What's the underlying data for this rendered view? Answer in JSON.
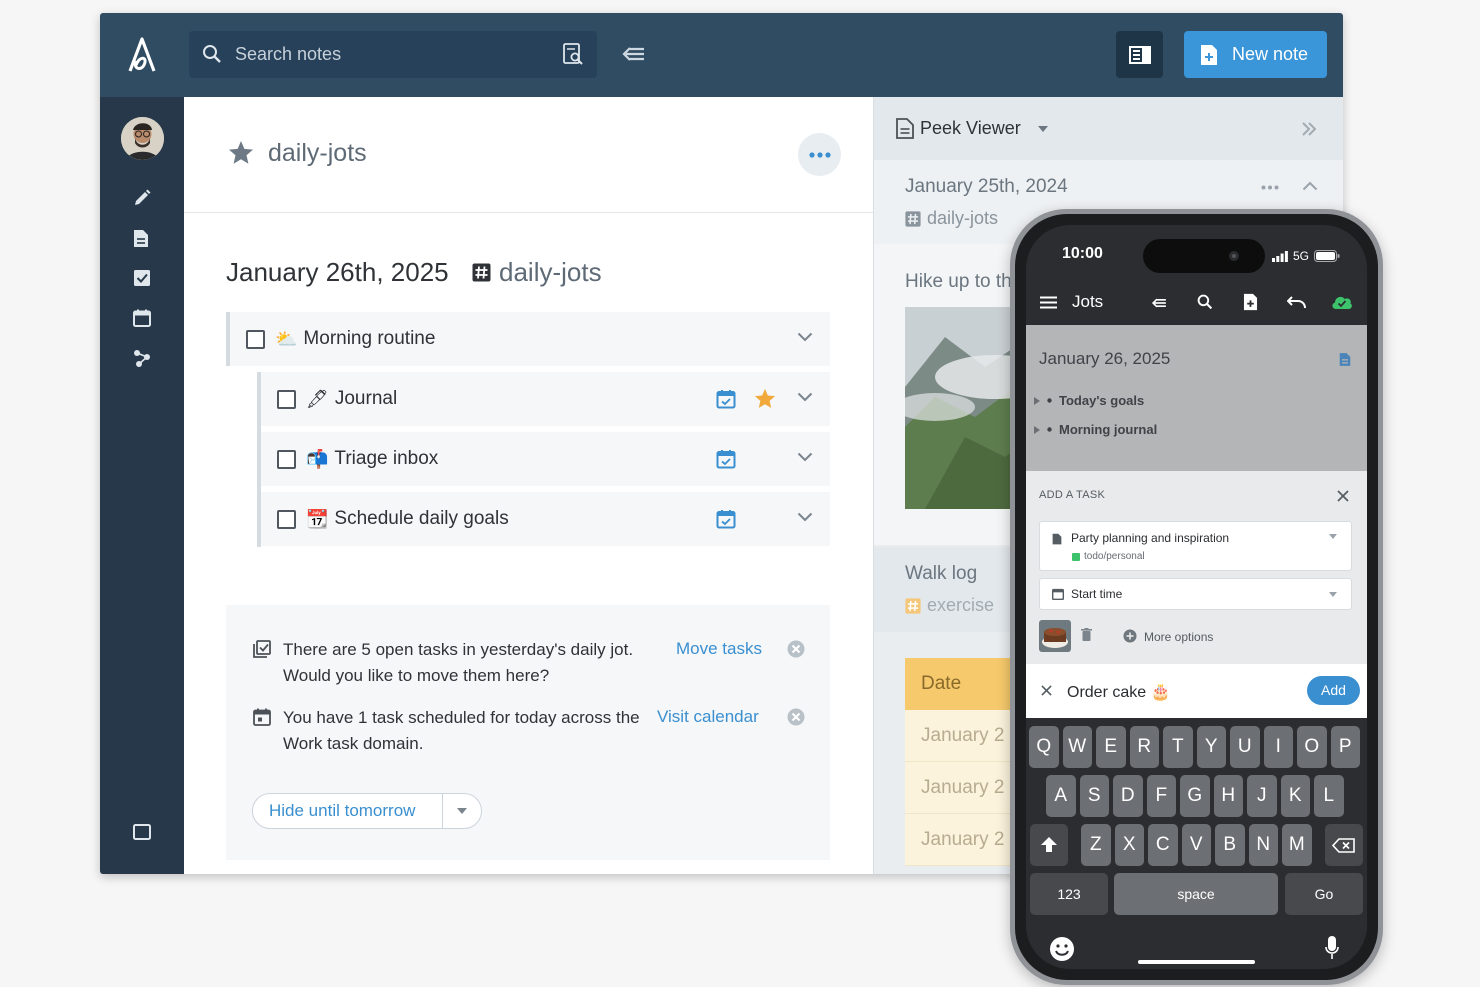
{
  "app": {
    "search_placeholder": "Search notes",
    "new_note_label": "New note",
    "note_title": "daily-jots",
    "date_heading": "January 26th, 2025",
    "date_tag": "daily-jots",
    "tasks": [
      {
        "emoji": "⛅",
        "label": "Morning routine"
      },
      {
        "emoji": "🖋",
        "label": "Journal"
      },
      {
        "emoji": "📬",
        "label": "Triage inbox"
      },
      {
        "emoji": "📆",
        "label": "Schedule daily goals"
      }
    ],
    "suggestions": [
      {
        "text": "There are 5 open tasks in yesterday's daily jot. Would you like to move them here?",
        "link": "Move tasks"
      },
      {
        "text": "You have 1 task scheduled for today across the Work task domain.",
        "link": "Visit calendar"
      }
    ],
    "hide_label": "Hide until tomorrow",
    "peek": {
      "title": "Peek Viewer",
      "note1_date": "January 25th, 2024",
      "note1_tag": "daily-jots",
      "note1_body": "Hike up to th",
      "note2_title": "Walk log",
      "note2_tag": "exercise",
      "table_header": "Date",
      "table_rows": [
        "January 2",
        "January 2",
        "January 2"
      ]
    }
  },
  "phone": {
    "time": "10:00",
    "network": "5G",
    "toolbar_title": "Jots",
    "note_date": "January 26, 2025",
    "bullets": [
      "Today's goals",
      "Morning journal"
    ],
    "add_task_label": "ADD A TASK",
    "note_field": "Party planning and inspiration",
    "note_field_tag": "todo/personal",
    "start_time": "Start time",
    "more_options": "More options",
    "task_text": "Order cake 🎂",
    "add_label": "Add",
    "keyboard": {
      "row1": [
        "Q",
        "W",
        "E",
        "R",
        "T",
        "Y",
        "U",
        "I",
        "O",
        "P"
      ],
      "row2": [
        "A",
        "S",
        "D",
        "F",
        "G",
        "H",
        "J",
        "K",
        "L"
      ],
      "row3": [
        "Z",
        "X",
        "C",
        "V",
        "B",
        "N",
        "M"
      ],
      "num": "123",
      "space": "space",
      "go": "Go"
    }
  },
  "colors": {
    "topbar": "#2f4c63",
    "sidebar": "#263849",
    "accent": "#3a96d8",
    "star": "#f2a93b"
  }
}
